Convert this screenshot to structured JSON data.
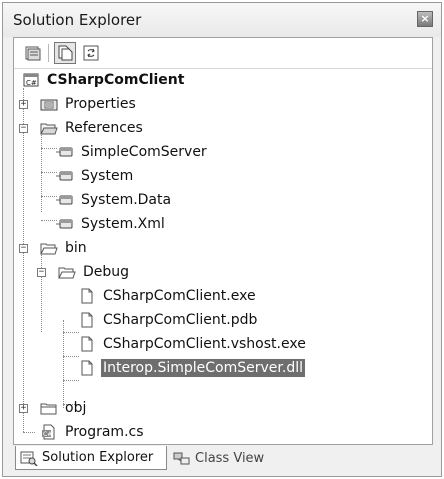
{
  "window": {
    "title": "Solution Explorer",
    "close_glyph": "×"
  },
  "toolbar": {
    "buttons": [
      {
        "icon": "properties-icon"
      },
      {
        "icon": "show-all-files-icon",
        "active": true
      },
      {
        "icon": "refresh-icon"
      }
    ]
  },
  "tree": {
    "project": "CSharpComClient",
    "properties": "Properties",
    "references": "References",
    "ref_items": [
      "SimpleComServer",
      "System",
      "System.Data",
      "System.Xml"
    ],
    "bin": "bin",
    "debug": "Debug",
    "debug_files": [
      "CSharpComClient.exe",
      "CSharpComClient.pdb",
      "CSharpComClient.vshost.exe",
      "Interop.SimpleComServer.dll"
    ],
    "obj": "obj",
    "program": "Program.cs"
  },
  "tabs": {
    "solution_explorer": "Solution Explorer",
    "class_view": "Class View"
  }
}
